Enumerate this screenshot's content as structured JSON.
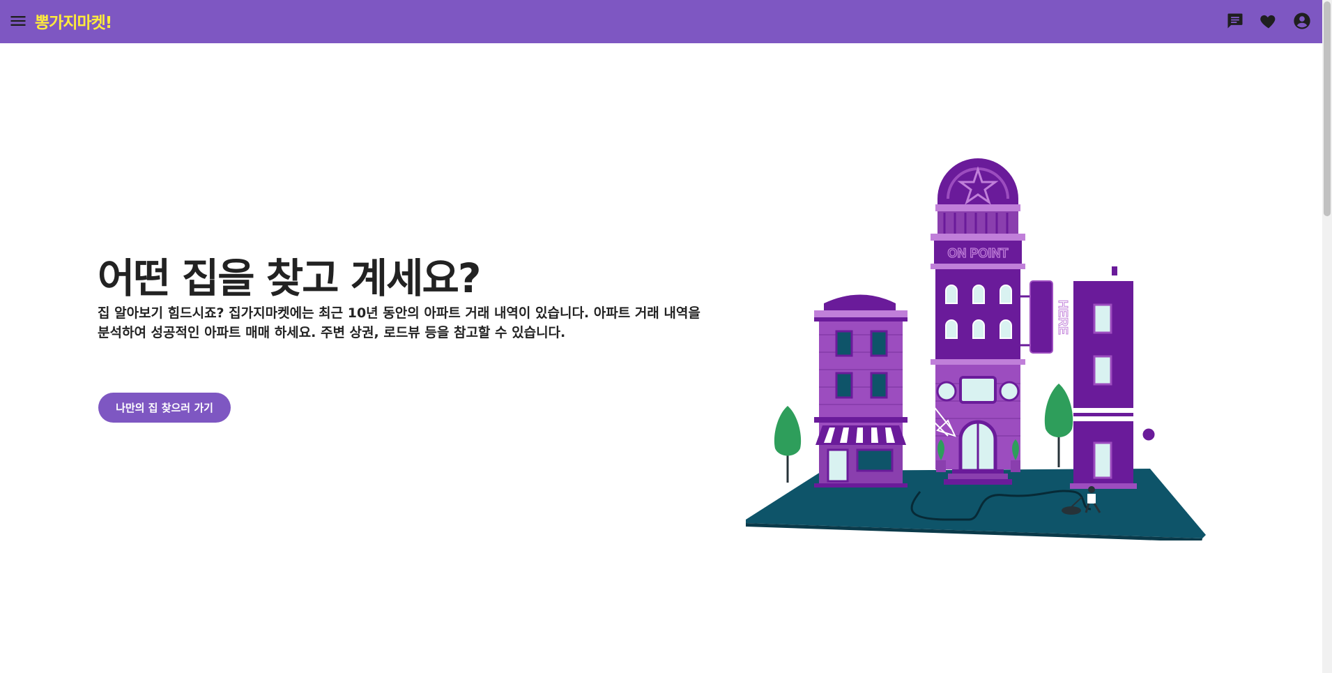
{
  "appbar": {
    "logo": "뽕가지마켓!",
    "icons": {
      "menu": "menu-icon",
      "chat": "chat-icon",
      "favorites": "heart-icon",
      "account": "account-circle-icon"
    }
  },
  "hero": {
    "title": "어떤 집을 찾고 계세요?",
    "description": "집 알아보기 힘드시죠? 집가지마켓에는 최근 10년 동안의 아파트 거래 내역이 있습니다. 아파트 거래 내역을 분석하여 성공적인 아파트 매매 하세요. 주변 상권, 로드뷰 등을 참고할 수 있습니다.",
    "cta_label": "나만의 집 찾으러 가기"
  },
  "illustration": {
    "marquee_text": "ON POINT",
    "sign_text": "HERE"
  },
  "colors": {
    "primary": "#7e57c2",
    "logo": "#ffeb3b",
    "text": "#222222",
    "building_dark": "#6a1b9a",
    "building_light": "#9c4dbf",
    "ground": "#0e5469",
    "tree": "#2e9e5b"
  }
}
